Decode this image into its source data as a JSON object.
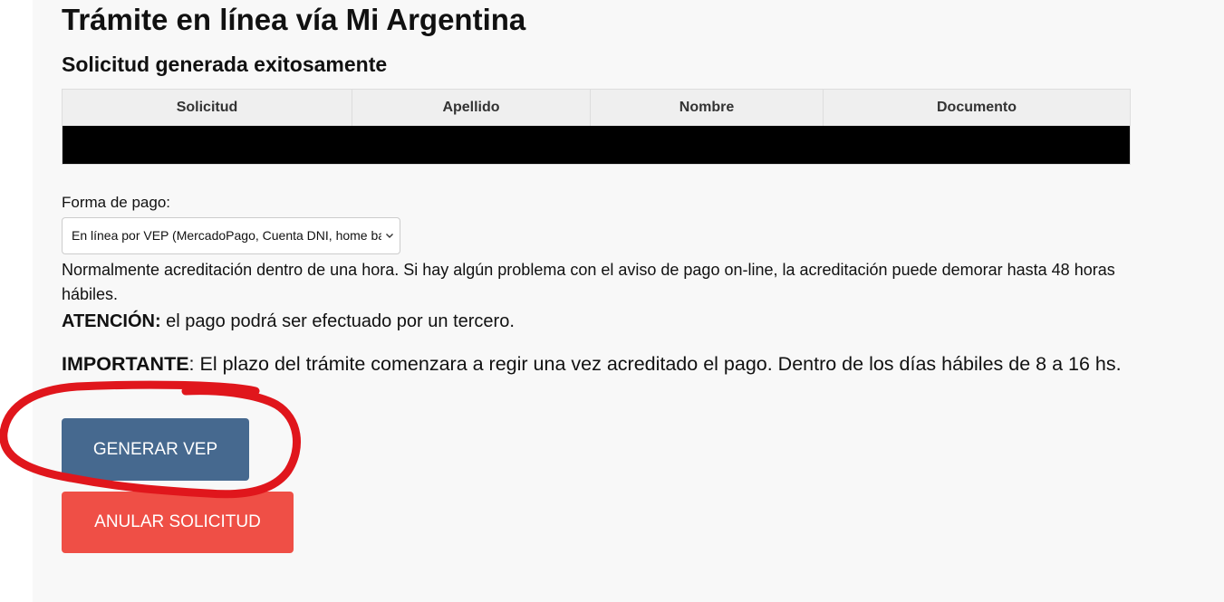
{
  "page": {
    "title": "Trámite en línea vía Mi Argentina",
    "subtitle": "Solicitud generada exitosamente"
  },
  "table": {
    "headers": [
      "Solicitud",
      "Apellido",
      "Nombre",
      "Documento"
    ],
    "rows": [
      [
        "",
        "",
        "",
        ""
      ]
    ]
  },
  "payment": {
    "label": "Forma de pago:",
    "selected_option": "En línea por VEP (MercadoPago, Cuenta DNI, home banking)",
    "chevron_icon": "chevron-down-icon"
  },
  "notes": {
    "info": "Normalmente acreditación dentro de una hora. Si hay algún problema con el aviso de pago on-line, la acreditación puede demorar hasta 48 horas hábiles.",
    "attention_label": "ATENCIÓN:",
    "attention_text": " el pago podrá ser efectuado por un tercero.",
    "important_label": "IMPORTANTE",
    "important_text": ": El plazo del trámite comenzara a regir una vez acreditado el pago. Dentro de los días hábiles de 8 a 16 hs."
  },
  "buttons": {
    "generate_vep": "GENERAR VEP",
    "cancel_request": "ANULAR SOLICITUD"
  },
  "colors": {
    "primary_button": "#46698f",
    "danger_button": "#ef4f46",
    "annotation_circle": "#e0161c",
    "page_background": "#f8f8f8"
  }
}
